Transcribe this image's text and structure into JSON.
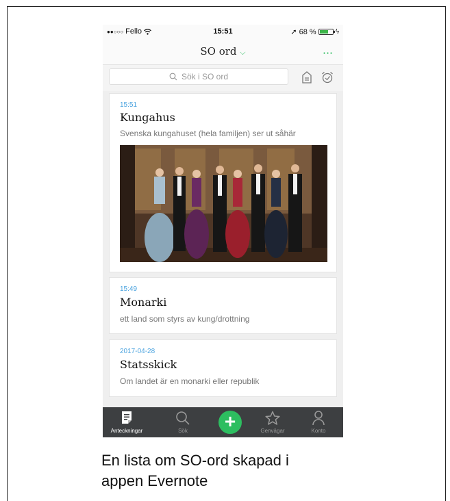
{
  "status_bar": {
    "signal_dots": "●●○○○",
    "carrier": "Fello",
    "time": "15:51",
    "location_arrow": "➚",
    "battery_percent": "68 %",
    "battery_level": 0.68,
    "charging": "ϟ"
  },
  "header": {
    "title": "SO ord",
    "dropdown_glyph": "⌵",
    "more_glyph": "●●●"
  },
  "search": {
    "placeholder": "Sök i SO ord",
    "magnifier": "⌕"
  },
  "notes": [
    {
      "date": "15:51",
      "title": "Kungahus",
      "snippet": "Svenska kungahuset (hela familjen) ser ut såhär",
      "has_image": true
    },
    {
      "date": "15:49",
      "title": "Monarki",
      "snippet": "ett land som styrs av kung/drottning"
    },
    {
      "date": "2017-04-28",
      "title": "Statsskick",
      "snippet": "Om landet är en monarki eller republik"
    }
  ],
  "tabbar": {
    "tabs": [
      {
        "label": "Anteckningar",
        "icon": "notes-icon",
        "active": true
      },
      {
        "label": "Sök",
        "icon": "search-icon"
      },
      {
        "label": "",
        "icon": "add-icon",
        "glyph": "+"
      },
      {
        "label": "Genvägar",
        "icon": "star-icon"
      },
      {
        "label": "Konto",
        "icon": "person-icon"
      }
    ]
  },
  "caption": {
    "line1": "En lista om SO-ord skapad i",
    "line2": "appen Evernote"
  },
  "colors": {
    "accent": "#2dbe60",
    "date_blue": "#4aa3df",
    "tabbar": "#3d3f41"
  }
}
